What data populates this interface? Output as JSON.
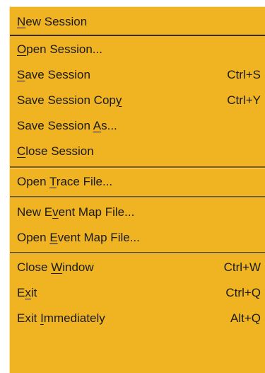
{
  "menu": {
    "items": [
      {
        "pre": "",
        "u": "N",
        "post": "ew Session",
        "accel": ""
      },
      {
        "pre": "",
        "u": "O",
        "post": "pen Session...",
        "accel": ""
      },
      {
        "pre": "",
        "u": "S",
        "post": "ave Session",
        "accel": "Ctrl+S"
      },
      {
        "pre": "Save Session Cop",
        "u": "y",
        "post": "",
        "accel": "Ctrl+Y"
      },
      {
        "pre": "Save Session ",
        "u": "A",
        "post": "s...",
        "accel": ""
      },
      {
        "pre": "",
        "u": "C",
        "post": "lose Session",
        "accel": ""
      },
      {
        "pre": "Open ",
        "u": "T",
        "post": "race File...",
        "accel": ""
      },
      {
        "pre": "New E",
        "u": "v",
        "post": "ent Map File...",
        "accel": ""
      },
      {
        "pre": "Open ",
        "u": "E",
        "post": "vent Map File...",
        "accel": ""
      },
      {
        "pre": "Close ",
        "u": "W",
        "post": "indow",
        "accel": "Ctrl+W"
      },
      {
        "pre": "E",
        "u": "x",
        "post": "it",
        "accel": "Ctrl+Q"
      },
      {
        "pre": "Exit ",
        "u": "I",
        "post": "mmediately",
        "accel": "Alt+Q"
      }
    ]
  },
  "colors": {
    "menu_background": "#f0b422",
    "text": "#1a1a1a",
    "separator": "#7a5a10"
  }
}
